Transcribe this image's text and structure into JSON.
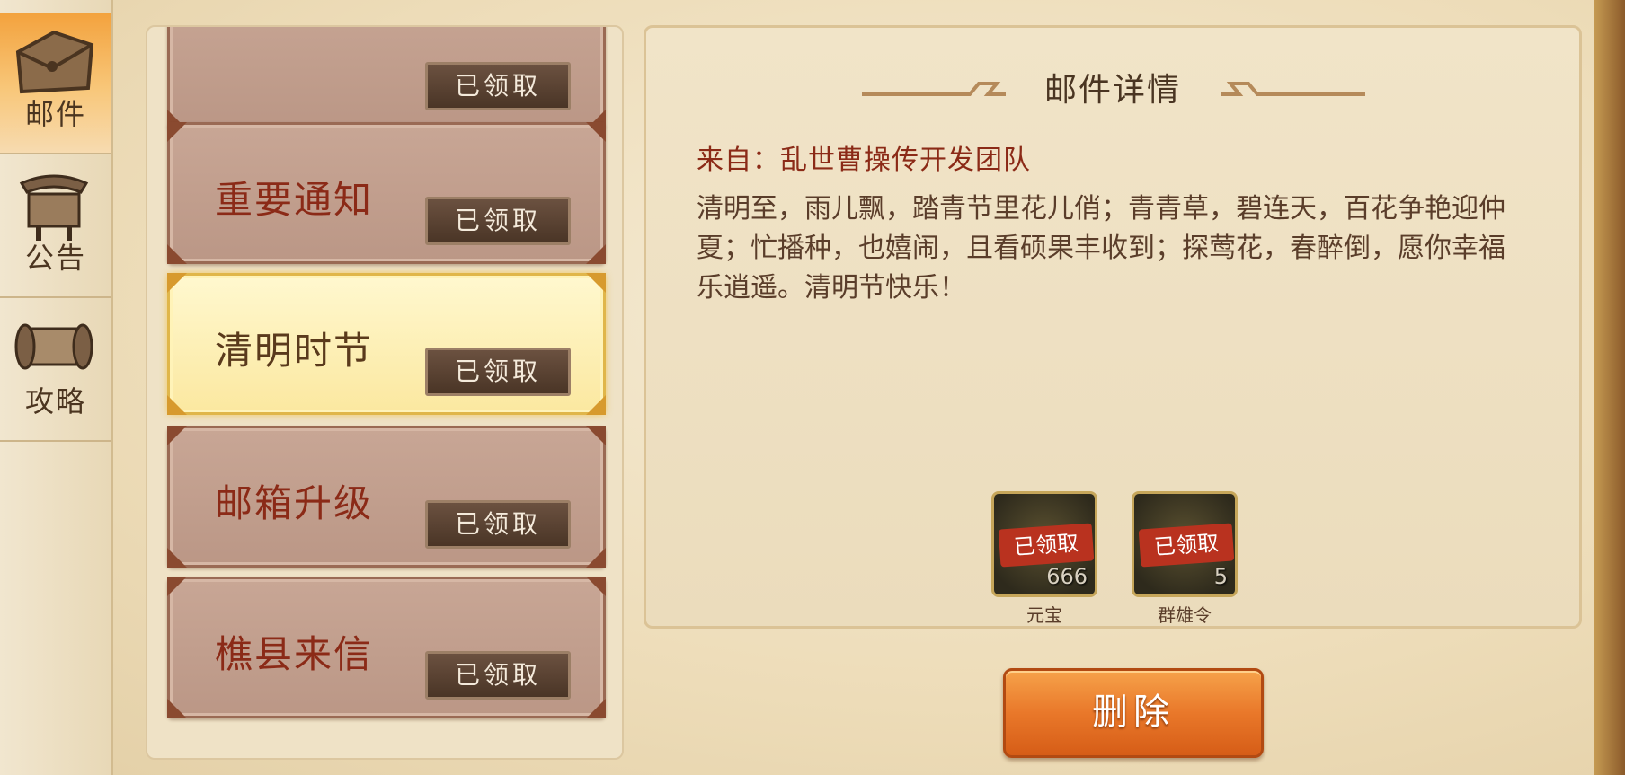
{
  "tabs": [
    {
      "label": "邮件",
      "icon": "mail-envelope-icon",
      "active": true
    },
    {
      "label": "公告",
      "icon": "notice-board-icon",
      "active": false
    },
    {
      "label": "攻略",
      "icon": "scroll-icon",
      "active": false
    }
  ],
  "mail_list": {
    "items": [
      {
        "title": "",
        "status": "已领取",
        "active": false
      },
      {
        "title": "重要通知",
        "status": "已领取",
        "active": false
      },
      {
        "title": "清明时节",
        "status": "已领取",
        "active": true
      },
      {
        "title": "邮箱升级",
        "status": "已领取",
        "active": false
      },
      {
        "title": "樵县来信",
        "status": "已领取",
        "active": false
      }
    ]
  },
  "detail": {
    "title": "邮件详情",
    "from": "来自：乱世曹操传开发团队",
    "body": "清明至，雨儿飘，踏青节里花儿俏；青青草，碧连天，百花争艳迎仲夏；忙播种，也嬉闹，且看硕果丰收到；探莺花，春醉倒，愿你幸福 乐逍遥。清明节快乐！",
    "rewards": [
      {
        "name": "元宝",
        "quantity": "666",
        "stamp": "已领取",
        "icon": "gold-ingot-icon"
      },
      {
        "name": "群雄令",
        "quantity": "5",
        "stamp": "已领取",
        "icon": "hero-token-icon"
      }
    ]
  },
  "actions": {
    "delete_label": "删除"
  },
  "colors": {
    "accent_orange": "#e9782a",
    "title_red": "#8b2a17",
    "item_bg": "#c8a695",
    "active_item_bg": "#fbe8a0"
  }
}
